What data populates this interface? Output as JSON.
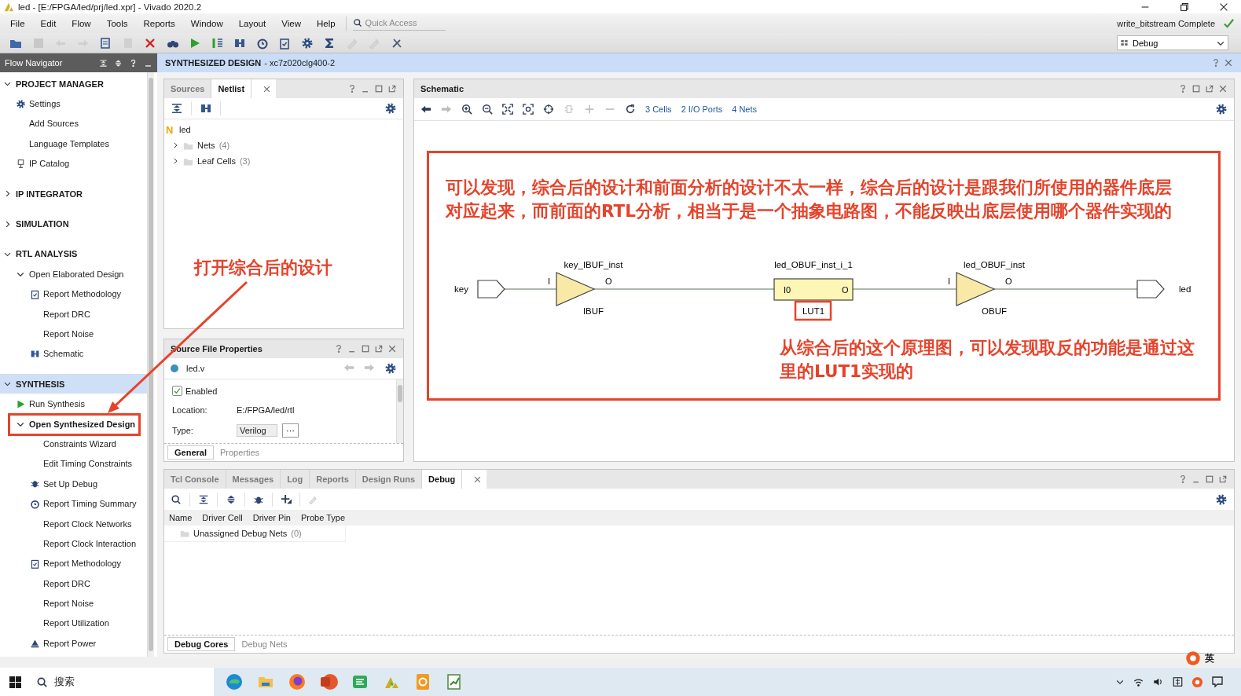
{
  "window": {
    "title": "led - [E:/FPGA/led/prj/led.xpr] - Vivado 2020.2"
  },
  "menu": [
    "File",
    "Edit",
    "Flow",
    "Tools",
    "Reports",
    "Window",
    "Layout",
    "View",
    "Help"
  ],
  "quick_access": {
    "placeholder": "Quick Access"
  },
  "run_status": "write_bitstream Complete",
  "layout_select": {
    "value": "Debug"
  },
  "flow_navigator": {
    "title": "Flow Navigator",
    "sections": [
      {
        "label": "PROJECT MANAGER",
        "expanded": true,
        "selected": false,
        "children": [
          {
            "label": "Settings",
            "kind": "gear"
          },
          {
            "label": "Add Sources"
          },
          {
            "label": "Language Templates"
          },
          {
            "label": "IP Catalog",
            "kind": "chip"
          }
        ]
      },
      {
        "label": "IP INTEGRATOR",
        "expanded": false,
        "selected": false
      },
      {
        "label": "SIMULATION",
        "expanded": false,
        "selected": false
      },
      {
        "label": "RTL ANALYSIS",
        "expanded": true,
        "selected": false,
        "children": [
          {
            "label": "Open Elaborated Design",
            "expanded": true,
            "open": false,
            "children": [
              {
                "label": "Report Methodology",
                "kind": "clipboard"
              },
              {
                "label": "Report DRC"
              },
              {
                "label": "Report Noise"
              },
              {
                "label": "Schematic",
                "kind": "schematic"
              }
            ]
          }
        ]
      },
      {
        "label": "SYNTHESIS",
        "expanded": true,
        "selected": true,
        "children": [
          {
            "label": "Run Synthesis",
            "kind": "run"
          },
          {
            "label": "Open Synthesized Design",
            "expanded": true,
            "open": true,
            "children": [
              {
                "label": "Constraints Wizard"
              },
              {
                "label": "Edit Timing Constraints"
              },
              {
                "label": "Set Up Debug",
                "kind": "bug"
              },
              {
                "label": "Report Timing Summary",
                "kind": "clock"
              },
              {
                "label": "Report Clock Networks"
              },
              {
                "label": "Report Clock Interaction"
              },
              {
                "label": "Report Methodology",
                "kind": "clipboard"
              },
              {
                "label": "Report DRC"
              },
              {
                "label": "Report Noise"
              },
              {
                "label": "Report Utilization"
              },
              {
                "label": "Report Power",
                "kind": "power"
              }
            ]
          }
        ]
      }
    ]
  },
  "design_header": {
    "title": "SYNTHESIZED DESIGN",
    "part": "- xc7z020clg400-2"
  },
  "netlist_panel": {
    "tabs": [
      {
        "label": "Sources",
        "selected": false
      },
      {
        "label": "Netlist",
        "selected": true
      }
    ],
    "tree": {
      "icon_letter": "N",
      "label": "led",
      "children": [
        {
          "label": "Nets",
          "count": "(4)",
          "expanded": false
        },
        {
          "label": "Leaf Cells",
          "count": "(3)",
          "expanded": false
        }
      ]
    }
  },
  "source_file_properties": {
    "title": "Source File Properties",
    "file": "led.v",
    "enabled": {
      "label": "Enabled",
      "checked": true
    },
    "fields": [
      {
        "label": "Location:",
        "value": "E:/FPGA/led/rtl",
        "kind": "text"
      },
      {
        "label": "Type:",
        "value": "Verilog",
        "kind": "combo",
        "button": "···"
      }
    ],
    "tabs": [
      {
        "label": "General",
        "selected": true
      },
      {
        "label": "Properties",
        "selected": false
      }
    ]
  },
  "schematic": {
    "title": "Schematic",
    "stats": [
      "3 Cells",
      "2 I/O Ports",
      "4 Nets"
    ],
    "ports": [
      {
        "name": "key",
        "kind": "input"
      },
      {
        "name": "led",
        "kind": "output"
      }
    ],
    "cells": [
      {
        "name": "key_IBUF_inst",
        "type": "IBUF",
        "kind": "buffer",
        "pins": [
          "I",
          "O"
        ]
      },
      {
        "name": "led_OBUF_inst_i_1",
        "type": "LUT1",
        "kind": "lut",
        "pins": [
          "I0",
          "O"
        ]
      },
      {
        "name": "led_OBUF_inst",
        "type": "OBUF",
        "kind": "buffer",
        "pins": [
          "I",
          "O"
        ]
      }
    ]
  },
  "annotations": {
    "nav_note": "打开综合后的设计",
    "schematic_note": "可以发现，综合后的设计和前面分析的设计不太一样，综合后的设计是跟我们所使用的器件底层对应起来，而前面的RTL分析，相当于是一个抽象电路图，不能反映出底层使用哪个器件实现的",
    "lut_note": "从综合后的这个原理图，可以发现取反的功能是通过这里的LUT1实现的"
  },
  "debug_panel": {
    "tabs": [
      {
        "label": "Tcl Console",
        "selected": false
      },
      {
        "label": "Messages",
        "selected": false
      },
      {
        "label": "Log",
        "selected": false
      },
      {
        "label": "Reports",
        "selected": false
      },
      {
        "label": "Design Runs",
        "selected": false
      },
      {
        "label": "Debug",
        "selected": true
      }
    ],
    "columns": [
      "Name",
      "Driver Cell",
      "Driver Pin",
      "Probe Type"
    ],
    "rows": [
      {
        "label": "Unassigned Debug Nets",
        "count": "(0)"
      }
    ],
    "bottom_tabs": [
      {
        "label": "Debug Cores",
        "selected": true
      },
      {
        "label": "Debug Nets",
        "selected": false
      }
    ]
  },
  "taskbar": {
    "search_placeholder": "搜索",
    "ime_mode": "英"
  }
}
